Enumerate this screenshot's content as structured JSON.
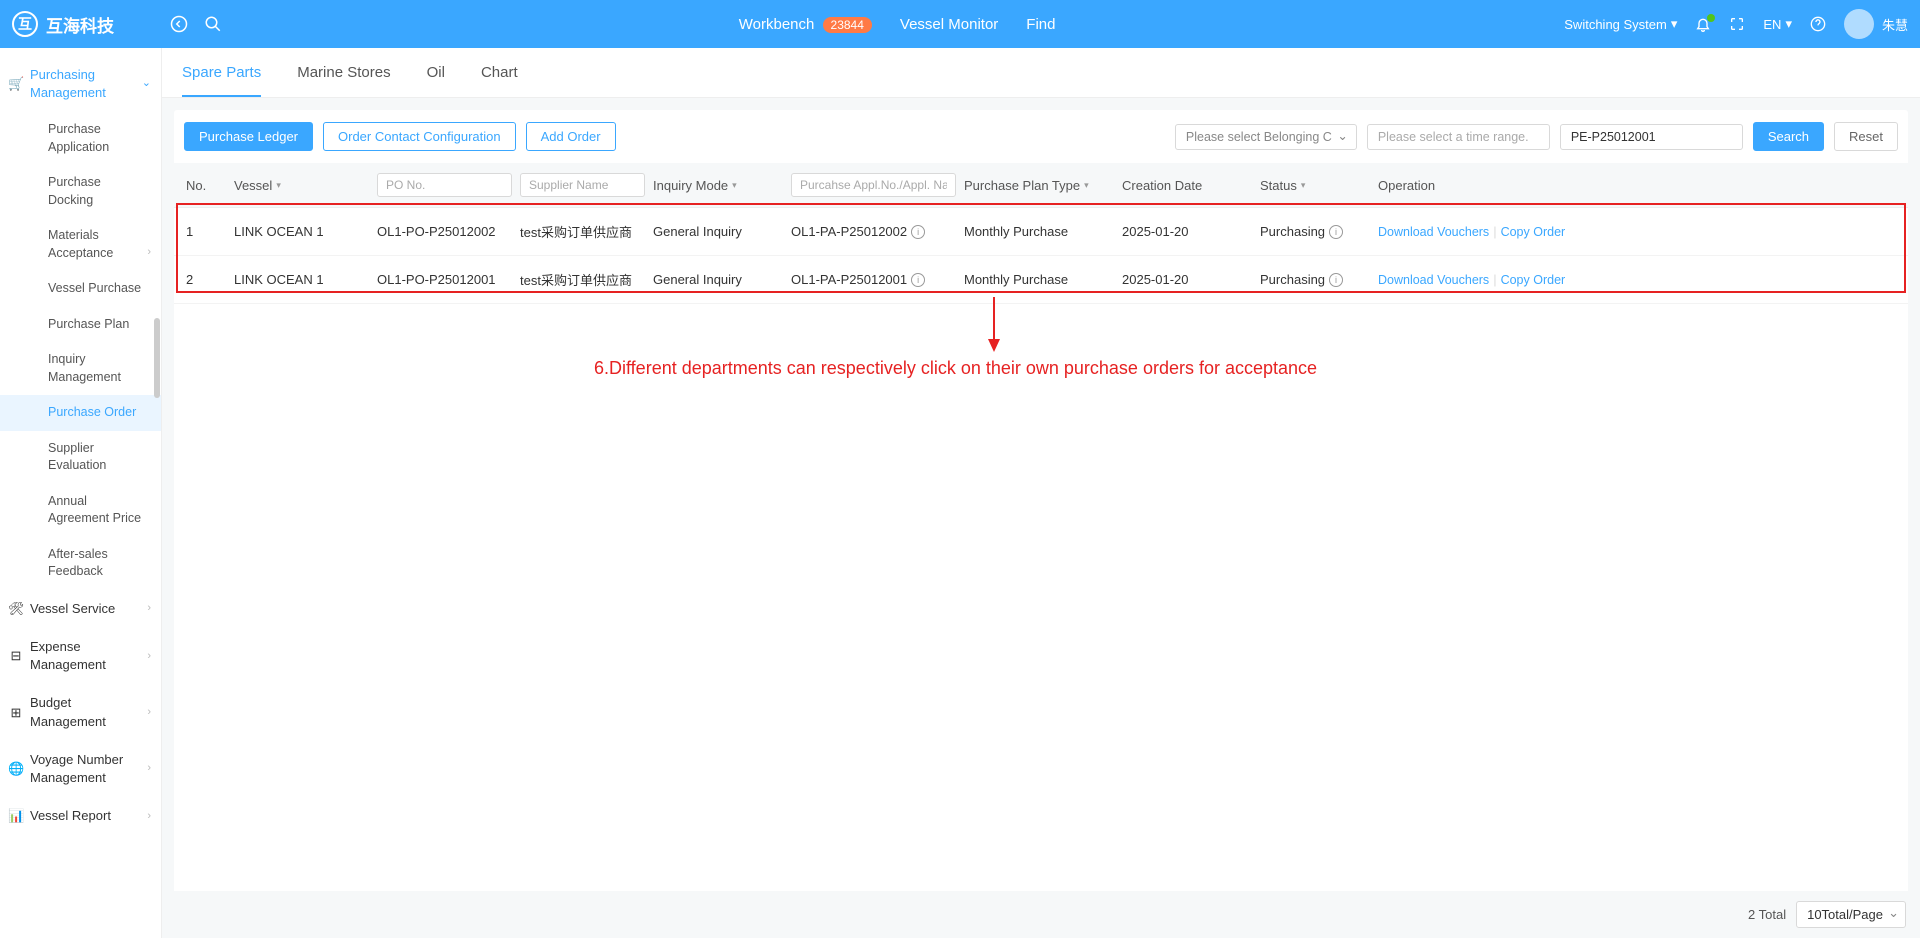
{
  "header": {
    "brand": "互海科技",
    "center": {
      "workbench": "Workbench",
      "badge": "23844",
      "vessel_monitor": "Vessel Monitor",
      "find": "Find"
    },
    "right": {
      "switching": "Switching System",
      "lang": "EN",
      "username": "朱慧"
    }
  },
  "sidebar": {
    "purchasing": "Purchasing Management",
    "items": {
      "purchase_application": "Purchase Application",
      "purchase_docking": "Purchase Docking",
      "materials_acceptance": "Materials Acceptance",
      "vessel_purchase": "Vessel Purchase",
      "purchase_plan": "Purchase Plan",
      "inquiry_management": "Inquiry Management",
      "purchase_order": "Purchase Order",
      "supplier_evaluation": "Supplier Evaluation",
      "annual_agreement": "Annual Agreement Price",
      "after_sales": "After-sales Feedback"
    },
    "vessel_service": "Vessel Service",
    "expense_management": "Expense Management",
    "budget_management": "Budget Management",
    "voyage_number": "Voyage Number Management",
    "vessel_report": "Vessel Report"
  },
  "tabs": {
    "spare_parts": "Spare Parts",
    "marine_stores": "Marine Stores",
    "oil": "Oil",
    "chart": "Chart"
  },
  "toolbar": {
    "purchase_ledger": "Purchase Ledger",
    "order_contact": "Order Contact Configuration",
    "add_order": "Add Order",
    "belonging_placeholder": "Please select Belonging C",
    "time_placeholder": "Please select a time range.",
    "search_value": "PE-P25012001",
    "search_btn": "Search",
    "reset_btn": "Reset"
  },
  "columns": {
    "no": "No.",
    "vessel": "Vessel",
    "po_placeholder": "PO No.",
    "supplier_placeholder": "Supplier Name",
    "inquiry_mode": "Inquiry Mode",
    "appl_placeholder": "Purcahse Appl.No./Appl. Na",
    "plan_type": "Purchase Plan Type",
    "creation_date": "Creation Date",
    "status": "Status",
    "operation": "Operation"
  },
  "rows": [
    {
      "no": "1",
      "vessel": "LINK OCEAN 1",
      "po": "OL1-PO-P25012002",
      "supplier": "test采购订单供应商",
      "inquiry": "General Inquiry",
      "appl": "OL1-PA-P25012002",
      "plan": "Monthly Purchase",
      "date": "2025-01-20",
      "status": "Purchasing",
      "download": "Download Vouchers",
      "copy": "Copy Order"
    },
    {
      "no": "2",
      "vessel": "LINK OCEAN 1",
      "po": "OL1-PO-P25012001",
      "supplier": "test采购订单供应商",
      "inquiry": "General Inquiry",
      "appl": "OL1-PA-P25012001",
      "plan": "Monthly Purchase",
      "date": "2025-01-20",
      "status": "Purchasing",
      "download": "Download Vouchers",
      "copy": "Copy Order"
    }
  ],
  "annotation": "6.Different departments can respectively click on their own purchase orders for acceptance",
  "footer": {
    "total": "2 Total",
    "per_page": "10Total/Page"
  }
}
